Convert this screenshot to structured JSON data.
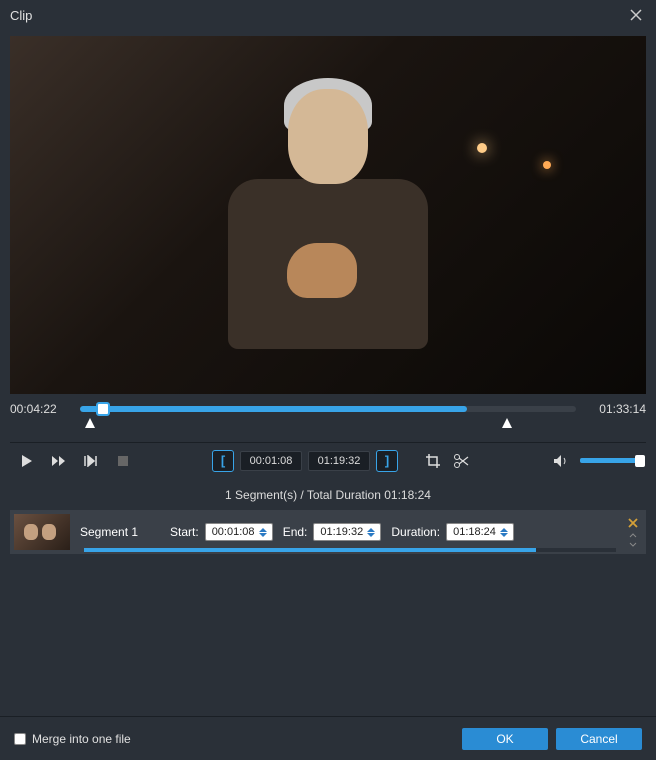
{
  "window": {
    "title": "Clip"
  },
  "playback": {
    "current_time": "00:04:22",
    "total_time": "01:33:14",
    "in_time": "00:01:08",
    "out_time": "01:19:32"
  },
  "summary": "1 Segment(s) / Total Duration 01:18:24",
  "segments": [
    {
      "name": "Segment 1",
      "start_label": "Start:",
      "start": "00:01:08",
      "end_label": "End:",
      "end": "01:19:32",
      "duration_label": "Duration:",
      "duration": "01:18:24"
    }
  ],
  "footer": {
    "merge_label": "Merge into one file",
    "ok": "OK",
    "cancel": "Cancel"
  }
}
